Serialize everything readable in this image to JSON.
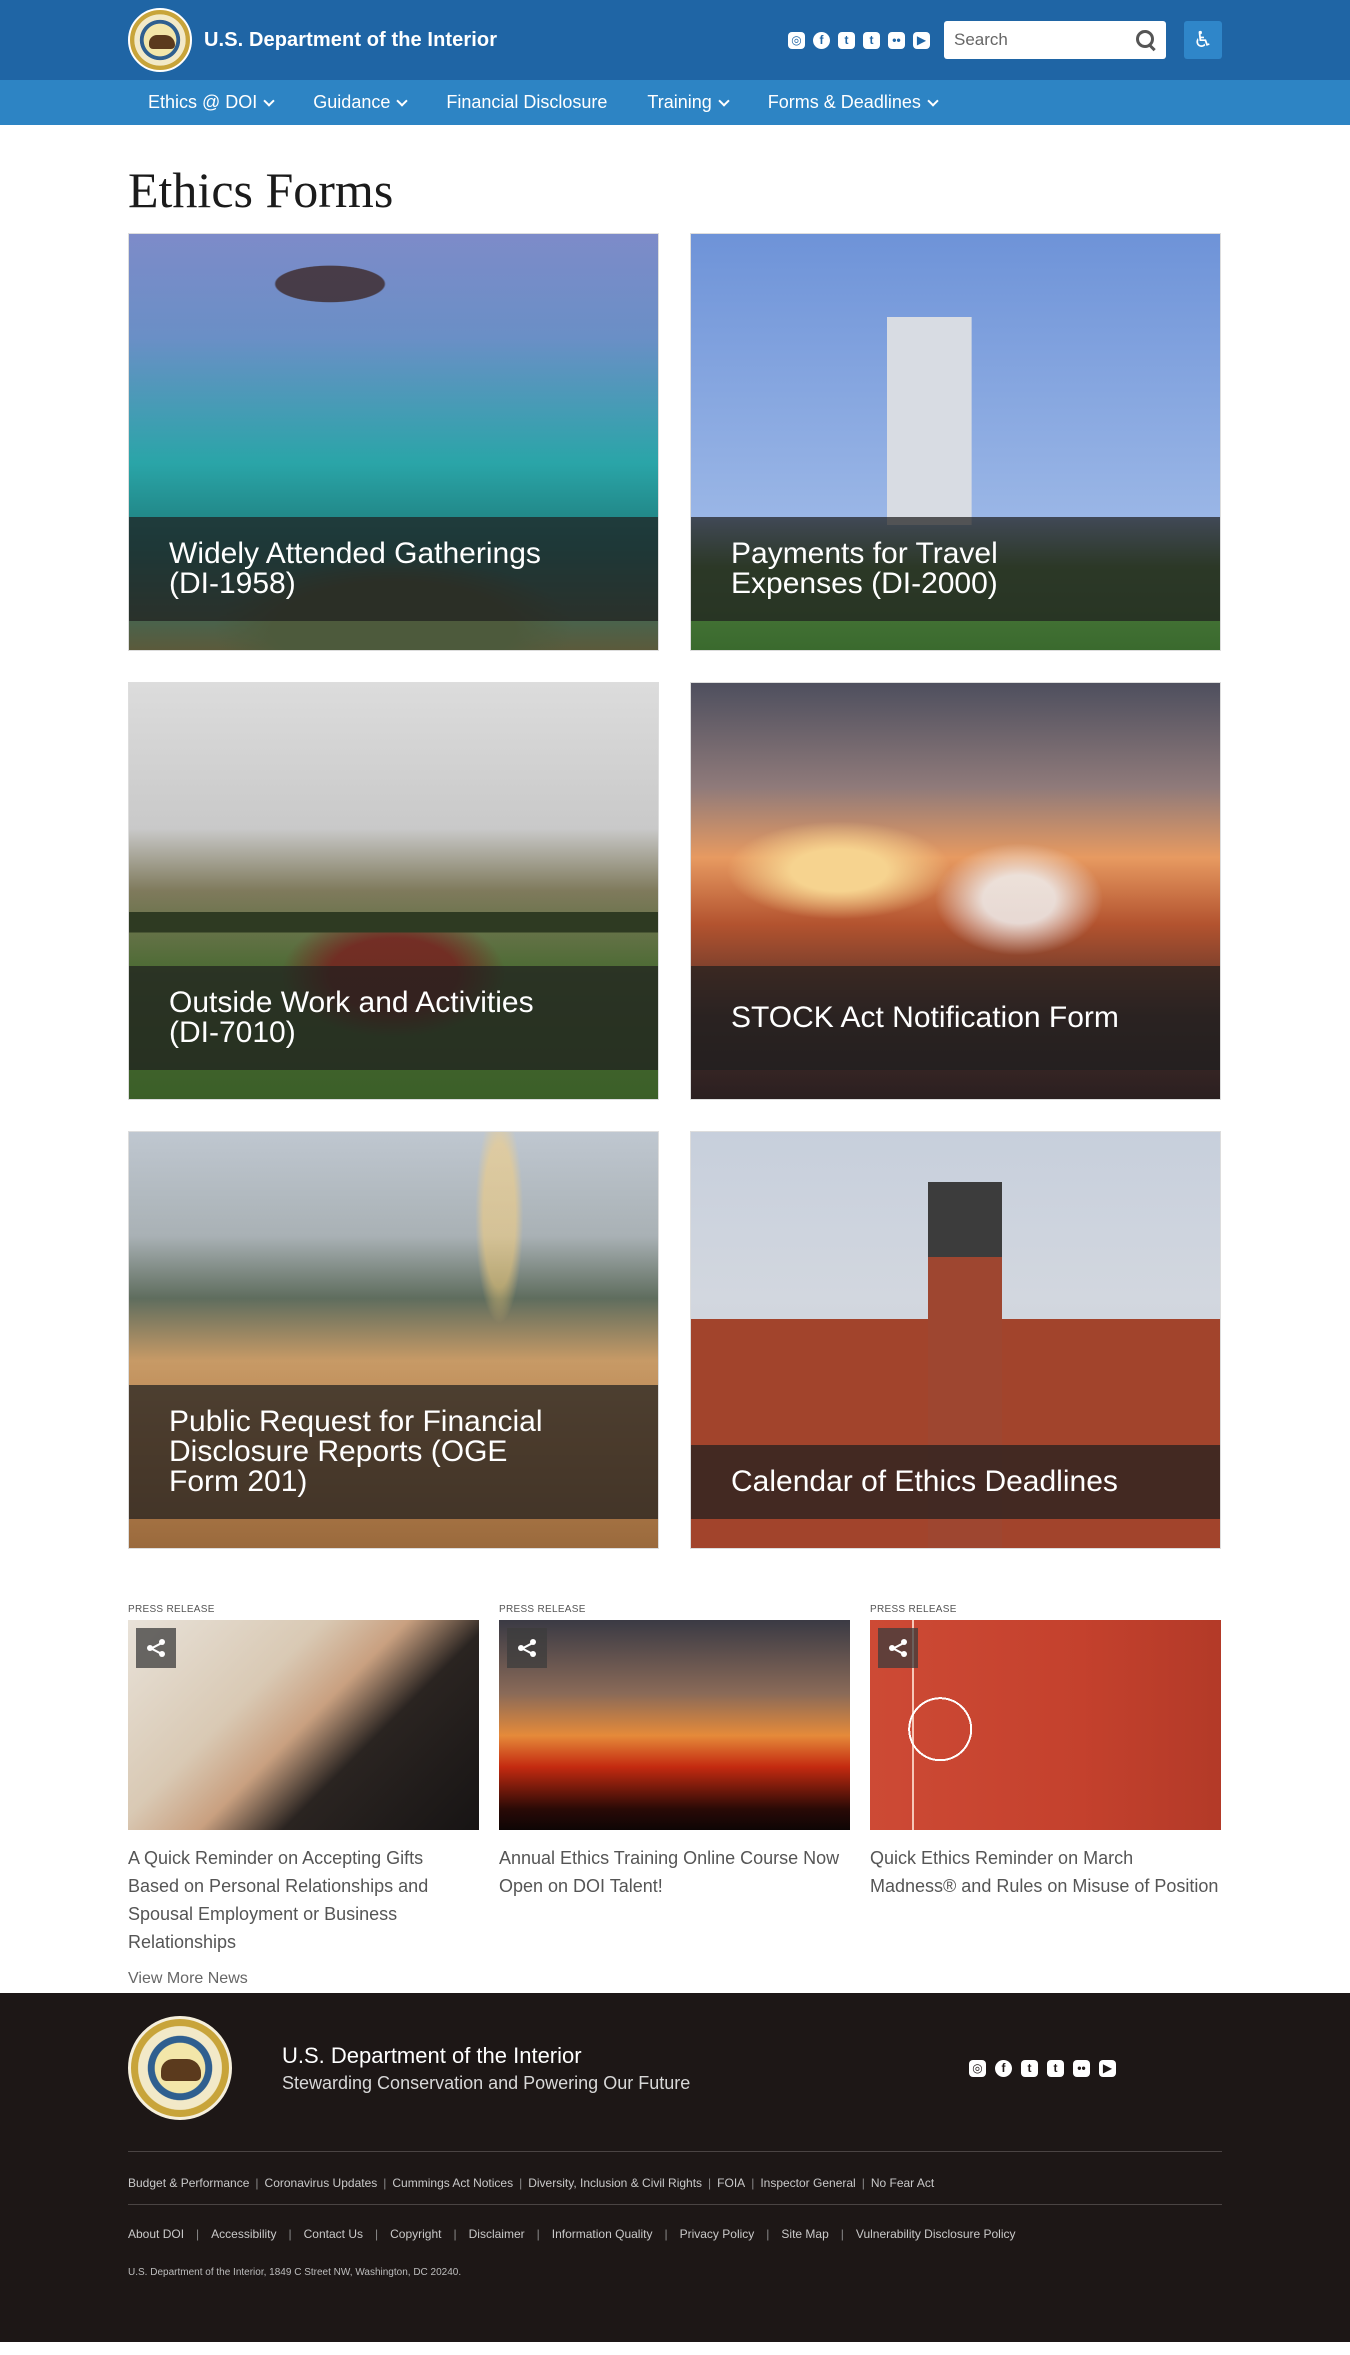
{
  "header": {
    "brand": "U.S. Department of the Interior",
    "search_placeholder": "Search",
    "social": [
      "instagram-icon",
      "facebook-icon",
      "twitter-icon",
      "tumblr-icon",
      "flickr-icon",
      "youtube-icon"
    ],
    "colors": {
      "topbar": "#1f65a5",
      "navbar": "#2d84c4"
    }
  },
  "nav": [
    {
      "label": "Ethics @ DOI",
      "dropdown": true
    },
    {
      "label": "Guidance",
      "dropdown": true
    },
    {
      "label": "Financial Disclosure",
      "dropdown": false
    },
    {
      "label": "Training",
      "dropdown": true
    },
    {
      "label": "Forms & Deadlines",
      "dropdown": true
    }
  ],
  "page": {
    "title": "Ethics Forms"
  },
  "cards": [
    {
      "title": "Widely Attended Gatherings (DI-1958)"
    },
    {
      "title": "Payments for Travel Expenses (DI-2000)"
    },
    {
      "title": "Outside Work and Activities (DI-7010)"
    },
    {
      "title": "STOCK Act Notification Form"
    },
    {
      "title": "Public Request for Financial Disclosure Reports (OGE Form 201)"
    },
    {
      "title": "Calendar of Ethics Deadlines"
    }
  ],
  "news": {
    "items": [
      {
        "kicker": "PRESS RELEASE",
        "headline": "A Quick Reminder on Accepting Gifts Based on Personal Relationships and Spousal Employment or Business Relationships"
      },
      {
        "kicker": "PRESS RELEASE",
        "headline": "Annual Ethics Training Online Course Now Open on DOI Talent!"
      },
      {
        "kicker": "PRESS RELEASE",
        "headline": "Quick Ethics Reminder on March Madness® and Rules on Misuse of Position"
      }
    ],
    "more_label": "View More News"
  },
  "footer": {
    "name": "U.S. Department of the Interior",
    "tagline": "Stewarding Conservation and Powering Our Future",
    "links_primary": [
      "Budget & Performance",
      "Coronavirus Updates",
      "Cummings Act Notices",
      "Diversity, Inclusion & Civil Rights",
      "FOIA",
      "Inspector General",
      "No Fear Act"
    ],
    "links_secondary": [
      "About DOI",
      "Accessibility",
      "Contact Us",
      "Copyright",
      "Disclaimer",
      "Information Quality",
      "Privacy Policy",
      "Site Map",
      "Vulnerability Disclosure Policy"
    ],
    "address": "U.S. Department of the Interior, 1849 C Street NW, Washington, DC 20240."
  }
}
